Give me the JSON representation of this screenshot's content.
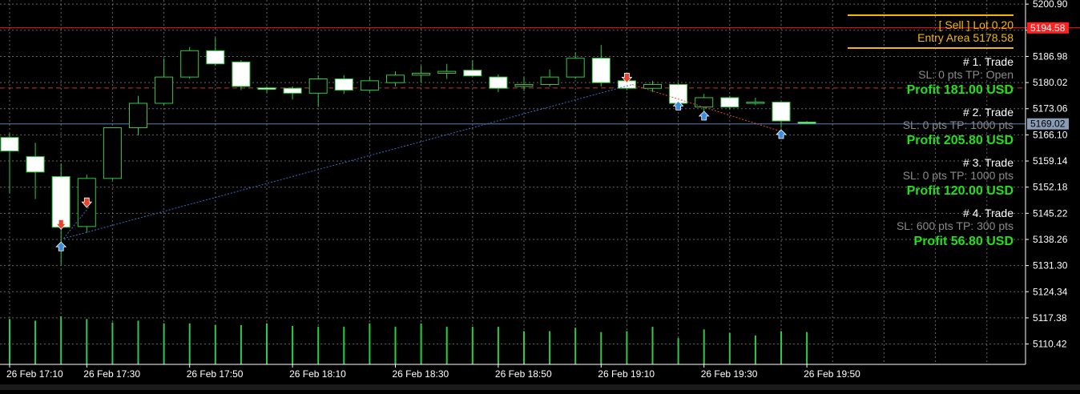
{
  "chart_data": {
    "type": "candlestick",
    "symbol_note": "",
    "ylim": [
      5105.0,
      5202.0
    ],
    "y_ticks": [
      5200.9,
      5193.94,
      5186.98,
      5180.02,
      5173.06,
      5166.1,
      5159.14,
      5152.18,
      5145.22,
      5138.26,
      5131.3,
      5124.34,
      5117.38,
      5110.42
    ],
    "y_tick_labels": [
      "5200.90",
      "",
      "5186.98",
      "5180.02",
      "5173.06",
      "5166.10",
      "5159.14",
      "5152.18",
      "5145.22",
      "5138.26",
      "5131.30",
      "5124.34",
      "5117.38",
      "5110.42"
    ],
    "x_tick_labels": [
      "26 Feb 17:10",
      "26 Feb 17:30",
      "26 Feb 17:50",
      "26 Feb 18:10",
      "26 Feb 18:30",
      "26 Feb 18:50",
      "26 Feb 19:10",
      "26 Feb 19:30",
      "26 Feb 19:50"
    ],
    "x_tick_bar_index": [
      0,
      3,
      7,
      11,
      15,
      19,
      23,
      27,
      31
    ],
    "candles": [
      {
        "o": 5165.4,
        "h": 5166.5,
        "l": 5150.5,
        "c": 5161.8
      },
      {
        "o": 5160.3,
        "h": 5164.0,
        "l": 5149.0,
        "c": 5156.2
      },
      {
        "o": 5155.0,
        "h": 5158.5,
        "l": 5131.5,
        "c": 5141.5
      },
      {
        "o": 5141.7,
        "h": 5155.5,
        "l": 5140.0,
        "c": 5154.5
      },
      {
        "o": 5154.5,
        "h": 5168.0,
        "l": 5154.0,
        "c": 5168.0
      },
      {
        "o": 5168.0,
        "h": 5176.5,
        "l": 5166.0,
        "c": 5174.5
      },
      {
        "o": 5174.5,
        "h": 5186.5,
        "l": 5174.0,
        "c": 5181.5
      },
      {
        "o": 5181.5,
        "h": 5189.5,
        "l": 5181.0,
        "c": 5188.5
      },
      {
        "o": 5188.5,
        "h": 5192.0,
        "l": 5184.5,
        "c": 5185.0
      },
      {
        "o": 5185.5,
        "h": 5186.0,
        "l": 5178.0,
        "c": 5179.0
      },
      {
        "o": 5178.6,
        "h": 5179.0,
        "l": 5177.2,
        "c": 5178.2
      },
      {
        "o": 5178.5,
        "h": 5179.0,
        "l": 5175.5,
        "c": 5177.2
      },
      {
        "o": 5177.2,
        "h": 5182.0,
        "l": 5173.5,
        "c": 5181.0
      },
      {
        "o": 5181.0,
        "h": 5182.0,
        "l": 5177.0,
        "c": 5178.0
      },
      {
        "o": 5178.0,
        "h": 5181.5,
        "l": 5177.5,
        "c": 5180.5
      },
      {
        "o": 5180.0,
        "h": 5183.0,
        "l": 5179.0,
        "c": 5182.0
      },
      {
        "o": 5182.0,
        "h": 5184.5,
        "l": 5180.0,
        "c": 5182.5
      },
      {
        "o": 5182.5,
        "h": 5185.0,
        "l": 5181.0,
        "c": 5183.0
      },
      {
        "o": 5183.3,
        "h": 5186.0,
        "l": 5181.8,
        "c": 5181.8
      },
      {
        "o": 5181.5,
        "h": 5182.2,
        "l": 5177.5,
        "c": 5178.5
      },
      {
        "o": 5179.0,
        "h": 5181.5,
        "l": 5177.8,
        "c": 5179.5
      },
      {
        "o": 5179.5,
        "h": 5183.5,
        "l": 5179.0,
        "c": 5181.5
      },
      {
        "o": 5181.5,
        "h": 5188.0,
        "l": 5181.0,
        "c": 5186.5
      },
      {
        "o": 5186.5,
        "h": 5190.0,
        "l": 5179.0,
        "c": 5180.0
      },
      {
        "o": 5180.5,
        "h": 5182.0,
        "l": 5178.0,
        "c": 5178.5
      },
      {
        "o": 5178.5,
        "h": 5180.5,
        "l": 5177.5,
        "c": 5179.5
      },
      {
        "o": 5179.5,
        "h": 5180.0,
        "l": 5173.0,
        "c": 5174.5
      },
      {
        "o": 5173.5,
        "h": 5177.0,
        "l": 5172.0,
        "c": 5176.0
      },
      {
        "o": 5176.0,
        "h": 5176.5,
        "l": 5173.0,
        "c": 5173.5
      },
      {
        "o": 5174.5,
        "h": 5176.0,
        "l": 5174.0,
        "c": 5174.8
      },
      {
        "o": 5174.8,
        "h": 5175.0,
        "l": 5168.0,
        "c": 5169.8
      },
      {
        "o": 5169.5,
        "h": 5169.8,
        "l": 5169.0,
        "c": 5169.3
      }
    ],
    "volume_relative": [
      0.52,
      0.5,
      0.55,
      0.52,
      0.48,
      0.5,
      0.47,
      0.47,
      0.45,
      0.45,
      0.47,
      0.44,
      0.43,
      0.43,
      0.47,
      0.43,
      0.47,
      0.43,
      0.43,
      0.43,
      0.38,
      0.38,
      0.42,
      0.37,
      0.38,
      0.43,
      0.3,
      0.4,
      0.36,
      0.33,
      0.38,
      0.37
    ],
    "entry_line_price": 5178.58,
    "red_line_price": 5194.58,
    "current_price": 5169.02,
    "price_tags": {
      "red": "5194.58",
      "current": "5169.02"
    },
    "trade_lines": [
      {
        "from": [
          2.1,
          5138.5
        ],
        "to": [
          24.2,
          5179.5
        ],
        "color": "#3a6dc6"
      },
      {
        "from": [
          24.2,
          5179.5
        ],
        "to": [
          30,
          5167.0
        ],
        "color": "#e84b2c"
      },
      {
        "from": [
          2.1,
          5138.5
        ],
        "to": [
          3.1,
          5147.0
        ],
        "color": "#3a6dc6"
      }
    ],
    "markers": [
      {
        "bar": 2,
        "price": 5141.8,
        "kind": "sell"
      },
      {
        "bar": 3,
        "price": 5147.6,
        "kind": "sell"
      },
      {
        "bar": 2,
        "price": 5136.5,
        "kind": "buy"
      },
      {
        "bar": 24,
        "price": 5180.8,
        "kind": "sell"
      },
      {
        "bar": 26,
        "price": 5174.0,
        "kind": "buy"
      },
      {
        "bar": 27,
        "price": 5171.3,
        "kind": "buy"
      },
      {
        "bar": 30,
        "price": 5166.4,
        "kind": "buy"
      }
    ]
  },
  "panel": {
    "header_line1": "[ Sell ]  Lot 0.20",
    "header_line2": "Entry Area 5178.58",
    "trades": [
      {
        "title": "# 1. Trade",
        "params": "SL: 0 pts   TP: Open",
        "profit": "Profit 181.00 USD"
      },
      {
        "title": "# 2. Trade",
        "params": "SL: 0 pts   TP: 1000 pts",
        "profit": "Profit 205.80 USD"
      },
      {
        "title": "# 3. Trade",
        "params": "SL: 0 pts   TP: 1000 pts",
        "profit": "Profit 120.00 USD"
      },
      {
        "title": "# 4. Trade",
        "params": "SL: 600 pts   TP: 300 pts",
        "profit": "Profit 56.80 USD"
      }
    ]
  },
  "colors": {
    "background": "#000000",
    "grid": "#b8b8b8",
    "bull_body": "#000000",
    "bear_body": "#ffffff",
    "wick": "#2ecc40",
    "volume": "#2ecc40",
    "panel_gold": "#f5b800",
    "profit_green": "#22e01c",
    "params_gray": "#8a8a8a",
    "red_line": "#ff2020",
    "entry_line": "#c0392b",
    "current_line": "#5a7fb5"
  }
}
